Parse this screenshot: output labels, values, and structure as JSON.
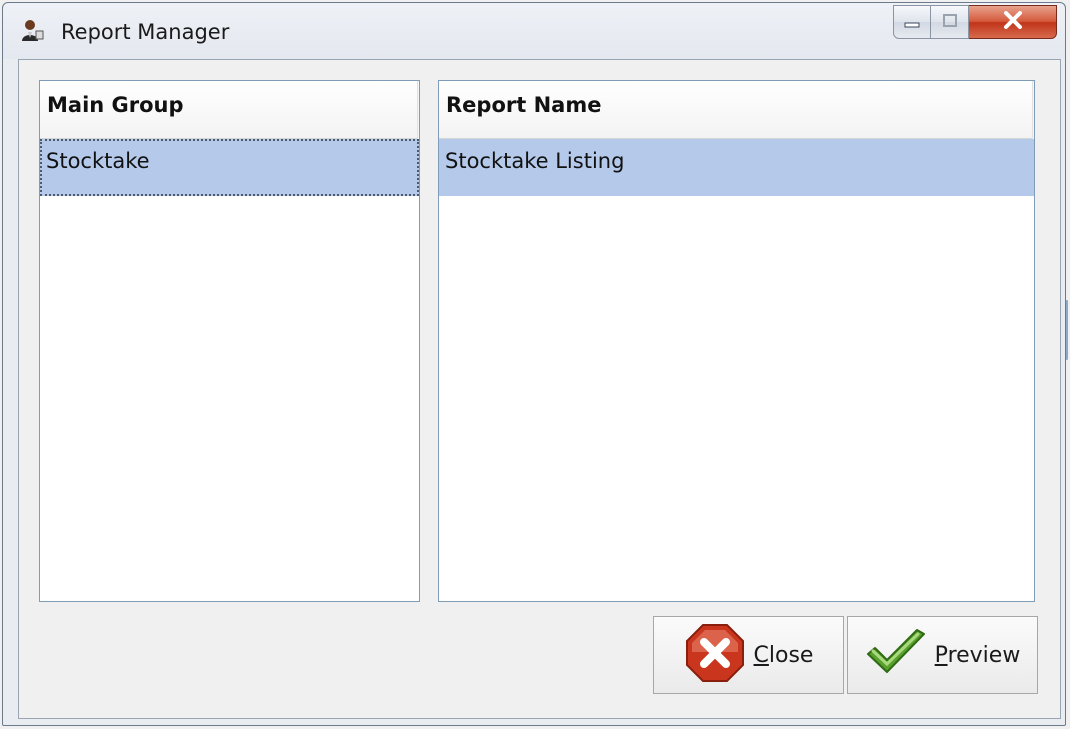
{
  "window": {
    "title": "Report Manager",
    "app_icon": "report-user-icon",
    "caption_buttons": {
      "minimize": "minimize-icon",
      "maximize": "maximize-icon",
      "close": "close-x-icon"
    }
  },
  "main_group_list": {
    "header": "Main Group",
    "items": [
      {
        "label": "Stocktake",
        "selected": true,
        "focused": true
      }
    ]
  },
  "report_name_list": {
    "header": "Report Name",
    "items": [
      {
        "label": "Stocktake Listing",
        "selected": true
      }
    ]
  },
  "buttons": {
    "close": {
      "mnemonic": "C",
      "rest": "lose",
      "icon": "red-x-stop-icon"
    },
    "preview": {
      "mnemonic": "P",
      "rest": "review",
      "icon": "green-check-icon"
    }
  },
  "colors": {
    "selection": "#b5c9ea",
    "panel_border": "#7f9db9",
    "close_red": "#c0341a",
    "check_green": "#5aa02c"
  }
}
